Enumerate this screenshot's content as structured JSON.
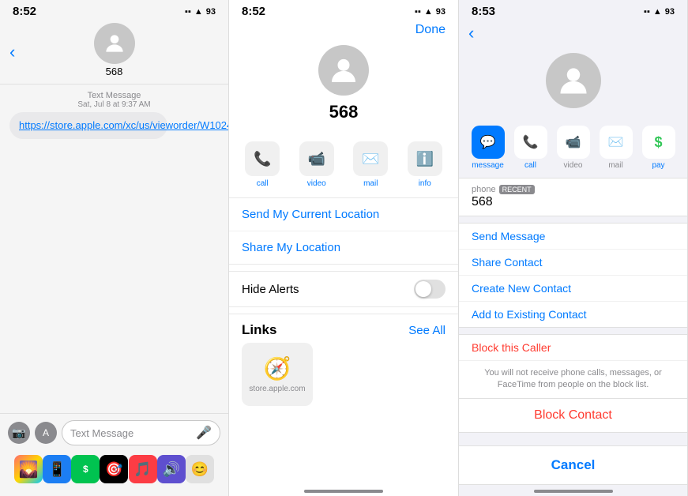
{
  "phone1": {
    "time": "8:52",
    "status_icons": "▪▪ ▲ WiFi 93",
    "contact_name": "568",
    "message_label": "Text Message",
    "message_date": "Sat, Jul 8 at 9:37 AM",
    "message_link": "https://store.apple.com/xc/us/vieworder/W1024",
    "input_placeholder": "Text Message",
    "dock_icons": [
      "🌄",
      "📱",
      "💳",
      "🎯",
      "🎵",
      "🔊",
      "😊"
    ]
  },
  "phone2": {
    "time": "8:52",
    "done_label": "Done",
    "contact_name": "568",
    "actions": [
      {
        "label": "call",
        "icon": "📞"
      },
      {
        "label": "video",
        "icon": "📹"
      },
      {
        "label": "mail",
        "icon": "✉️"
      },
      {
        "label": "info",
        "icon": "ℹ️"
      }
    ],
    "location_items": [
      "Send My Current Location",
      "Share My Location"
    ],
    "hide_alerts_label": "Hide Alerts",
    "links_label": "Links",
    "see_all_label": "See All",
    "link_url": "store.apple.com"
  },
  "phone3": {
    "time": "8:53",
    "phone_label": "phone",
    "recent_badge": "RECENT",
    "phone_number": "568",
    "actions": [
      {
        "label": "message",
        "icon": "💬",
        "blue": true
      },
      {
        "label": "call",
        "icon": "📞"
      },
      {
        "label": "video",
        "icon": "📹"
      },
      {
        "label": "mail",
        "icon": "✉️"
      },
      {
        "label": "pay",
        "icon": "$"
      }
    ],
    "menu_items": [
      {
        "text": "Send Message",
        "color": "blue"
      },
      {
        "text": "Share Contact",
        "color": "blue"
      },
      {
        "text": "Create New Contact",
        "color": "blue"
      },
      {
        "text": "Add to Existing Contact",
        "color": "blue"
      }
    ],
    "block_caller_label": "Block this Caller",
    "block_info": "You will not receive phone calls, messages, or FaceTime from people on the block list.",
    "block_contact_label": "Block Contact",
    "cancel_label": "Cancel"
  }
}
